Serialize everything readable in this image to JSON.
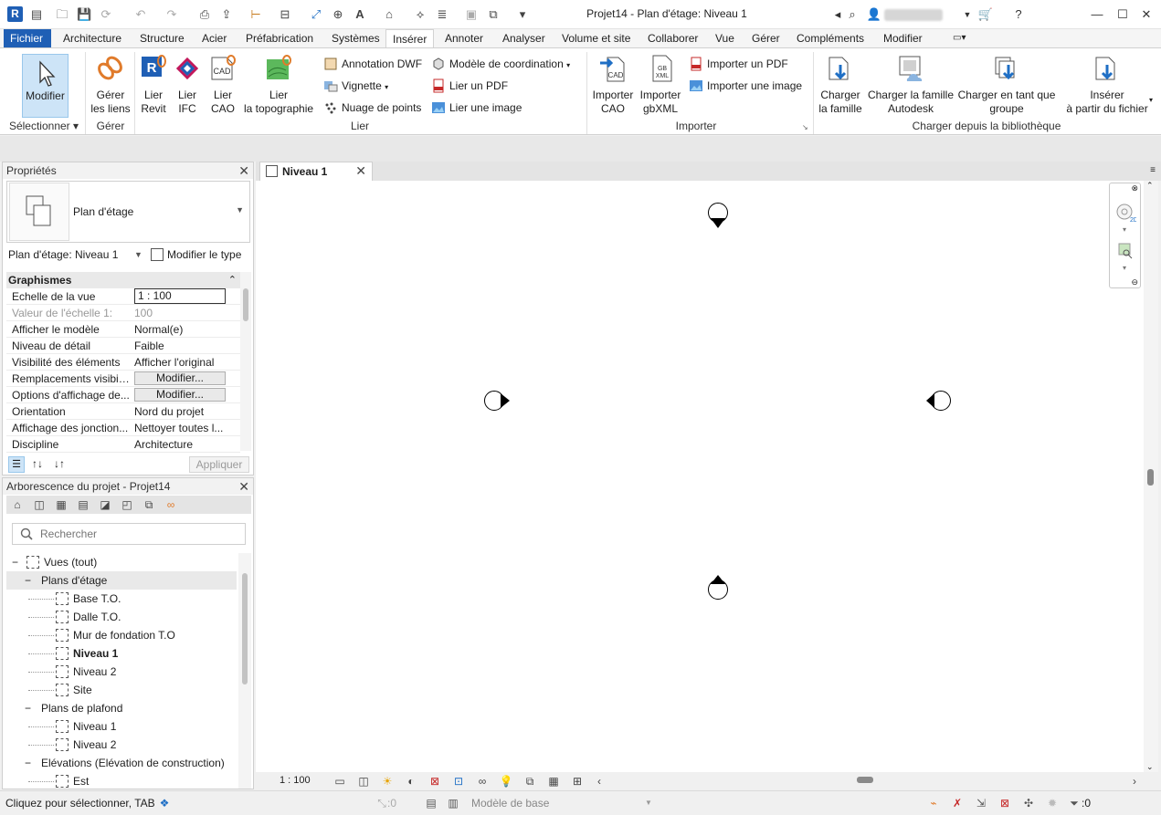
{
  "titlebar": {
    "title": "Projet14 - Plan d'étage: Niveau 1",
    "app_logo_letter": "R"
  },
  "tabs": [
    "Fichier",
    "Architecture",
    "Structure",
    "Acier",
    "Préfabrication",
    "Systèmes",
    "Insérer",
    "Annoter",
    "Analyser",
    "Volume et site",
    "Collaborer",
    "Vue",
    "Gérer",
    "Compléments",
    "Modifier"
  ],
  "active_tab": "Insérer",
  "ribbon": {
    "modifier": "Modifier",
    "gerer_liens": [
      "Gérer",
      "les liens"
    ],
    "lier_revit": [
      "Lier",
      "Revit"
    ],
    "lier_ifc": [
      "Lier",
      "IFC"
    ],
    "lier_cao": [
      "Lier",
      "CAO"
    ],
    "lier_topo": [
      "Lier",
      "la topographie"
    ],
    "annotation_dwf": "Annotation DWF",
    "vignette": "Vignette",
    "nuage_points": "Nuage de points",
    "modele_coord": "Modèle de  coordination",
    "lier_pdf": "Lier un  PDF",
    "lier_image": "Lier une  image",
    "importer_cao": [
      "Importer",
      "CAO"
    ],
    "importer_gbxml": [
      "Importer",
      "gbXML"
    ],
    "importer_pdf": "Importer un  PDF",
    "importer_image": "Importer une  image",
    "charger_famille": [
      "Charger",
      "la famille"
    ],
    "charger_autodesk": [
      "Charger la famille",
      "Autodesk"
    ],
    "charger_groupe": [
      "Charger en tant que",
      "groupe"
    ],
    "inserer_fichier": [
      "Insérer",
      "à partir du fichier"
    ],
    "panels": {
      "selectionner": "Sélectionner",
      "gerer": "Gérer",
      "lier": "Lier",
      "importer": "Importer",
      "charger": "Charger depuis la bibliothèque"
    }
  },
  "properties": {
    "title": "Propriétés",
    "type_name": "Plan d'étage",
    "instance_selector": "Plan d'étage: Niveau 1",
    "edit_type": "Modifier le type",
    "group": "Graphismes",
    "rows": [
      {
        "name": "Echelle de la vue",
        "value": "1 : 100",
        "kind": "box"
      },
      {
        "name": "Valeur de l'échelle    1:",
        "value": "100",
        "kind": "gray"
      },
      {
        "name": "Afficher le modèle",
        "value": "Normal(e)",
        "kind": "text"
      },
      {
        "name": "Niveau de détail",
        "value": "Faible",
        "kind": "text"
      },
      {
        "name": "Visibilité des éléments",
        "value": "Afficher l'original",
        "kind": "text"
      },
      {
        "name": "Remplacements visibili...",
        "value": "Modifier...",
        "kind": "btn"
      },
      {
        "name": "Options d'affichage de...",
        "value": "Modifier...",
        "kind": "btn"
      },
      {
        "name": "Orientation",
        "value": "Nord du projet",
        "kind": "text"
      },
      {
        "name": "Affichage des jonction...",
        "value": "Nettoyer toutes l...",
        "kind": "text"
      },
      {
        "name": "Discipline",
        "value": "Architecture",
        "kind": "text"
      }
    ],
    "apply": "Appliquer"
  },
  "browser": {
    "title": "Arborescence du projet - Projet14",
    "search_placeholder": "Rechercher",
    "nodes": [
      {
        "label": "Vues (tout)",
        "level": 0
      },
      {
        "label": "Plans d'étage",
        "level": 1
      },
      {
        "label": "Base T.O.",
        "level": 2
      },
      {
        "label": "Dalle T.O.",
        "level": 2
      },
      {
        "label": "Mur de fondation T.O",
        "level": 2
      },
      {
        "label": "Niveau 1",
        "level": 2,
        "bold": true
      },
      {
        "label": "Niveau 2",
        "level": 2
      },
      {
        "label": "Site",
        "level": 2
      },
      {
        "label": "Plans de plafond",
        "level": 1
      },
      {
        "label": "Niveau 1",
        "level": 2
      },
      {
        "label": "Niveau 2",
        "level": 2
      },
      {
        "label": "Elévations (Elévation de construction)",
        "level": 1
      },
      {
        "label": "Est",
        "level": 2
      }
    ]
  },
  "view": {
    "tab_label": "Niveau 1",
    "scale": "1 : 100"
  },
  "statusbar": {
    "text": "Cliquez pour sélectionner, TAB",
    "worksets_count": ":0",
    "model": "Modèle de base",
    "filter_count": ":0"
  }
}
